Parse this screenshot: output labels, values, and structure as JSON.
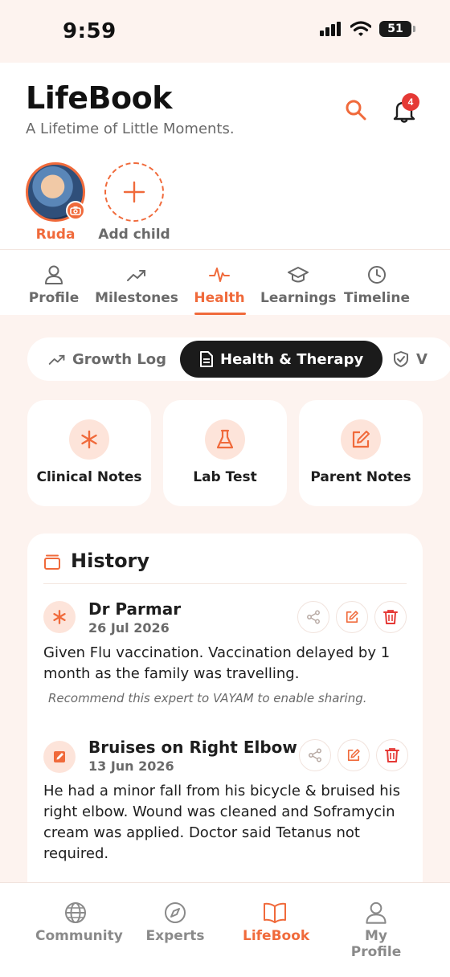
{
  "status": {
    "time": "9:59",
    "battery": "51"
  },
  "header": {
    "title": "LifeBook",
    "subtitle": "A Lifetime of Little Moments.",
    "notification_count": "4"
  },
  "children": {
    "selected_name": "Ruda",
    "add_label": "Add child"
  },
  "tabs": [
    {
      "label": "Profile",
      "icon": "person-icon"
    },
    {
      "label": "Milestones",
      "icon": "trend-icon"
    },
    {
      "label": "Health",
      "icon": "pulse-icon",
      "active": true
    },
    {
      "label": "Learnings",
      "icon": "graduation-cap-icon"
    },
    {
      "label": "Timeline",
      "icon": "clock-icon"
    }
  ],
  "segments": [
    {
      "label": "Growth Log",
      "icon": "trend-icon"
    },
    {
      "label": "Health & Therapy",
      "icon": "document-icon",
      "active": true
    },
    {
      "label": "V",
      "icon": "shield-icon"
    }
  ],
  "cards": [
    {
      "label": "Clinical Notes",
      "icon": "asterisk-icon"
    },
    {
      "label": "Lab Test",
      "icon": "flask-icon"
    },
    {
      "label": "Parent Notes",
      "icon": "edit-icon"
    }
  ],
  "history": {
    "title": "History",
    "entries": [
      {
        "title": "Dr Parmar",
        "date": "26 Jul 2026",
        "text": "Given Flu vaccination. Vaccination delayed by 1 month as the family was travelling.",
        "note": "Recommend this expert to VAYAM to enable sharing."
      },
      {
        "title": "Bruises on Right Elbow",
        "date": "13 Jun 2026",
        "text": "He had a minor fall from his bicycle & bruised his right elbow. Wound was cleaned and Soframycin cream was applied. Doctor said Tetanus not required."
      }
    ]
  },
  "bottom_nav": [
    {
      "label": "Community",
      "icon": "globe-icon"
    },
    {
      "label": "Experts",
      "icon": "compass-icon"
    },
    {
      "label": "LifeBook",
      "icon": "book-icon",
      "active": true
    },
    {
      "label": "My Profile",
      "icon": "person-icon"
    }
  ],
  "colors": {
    "accent": "#f06a3b",
    "dark": "#1b1b1b",
    "background": "#fdf3ef"
  }
}
